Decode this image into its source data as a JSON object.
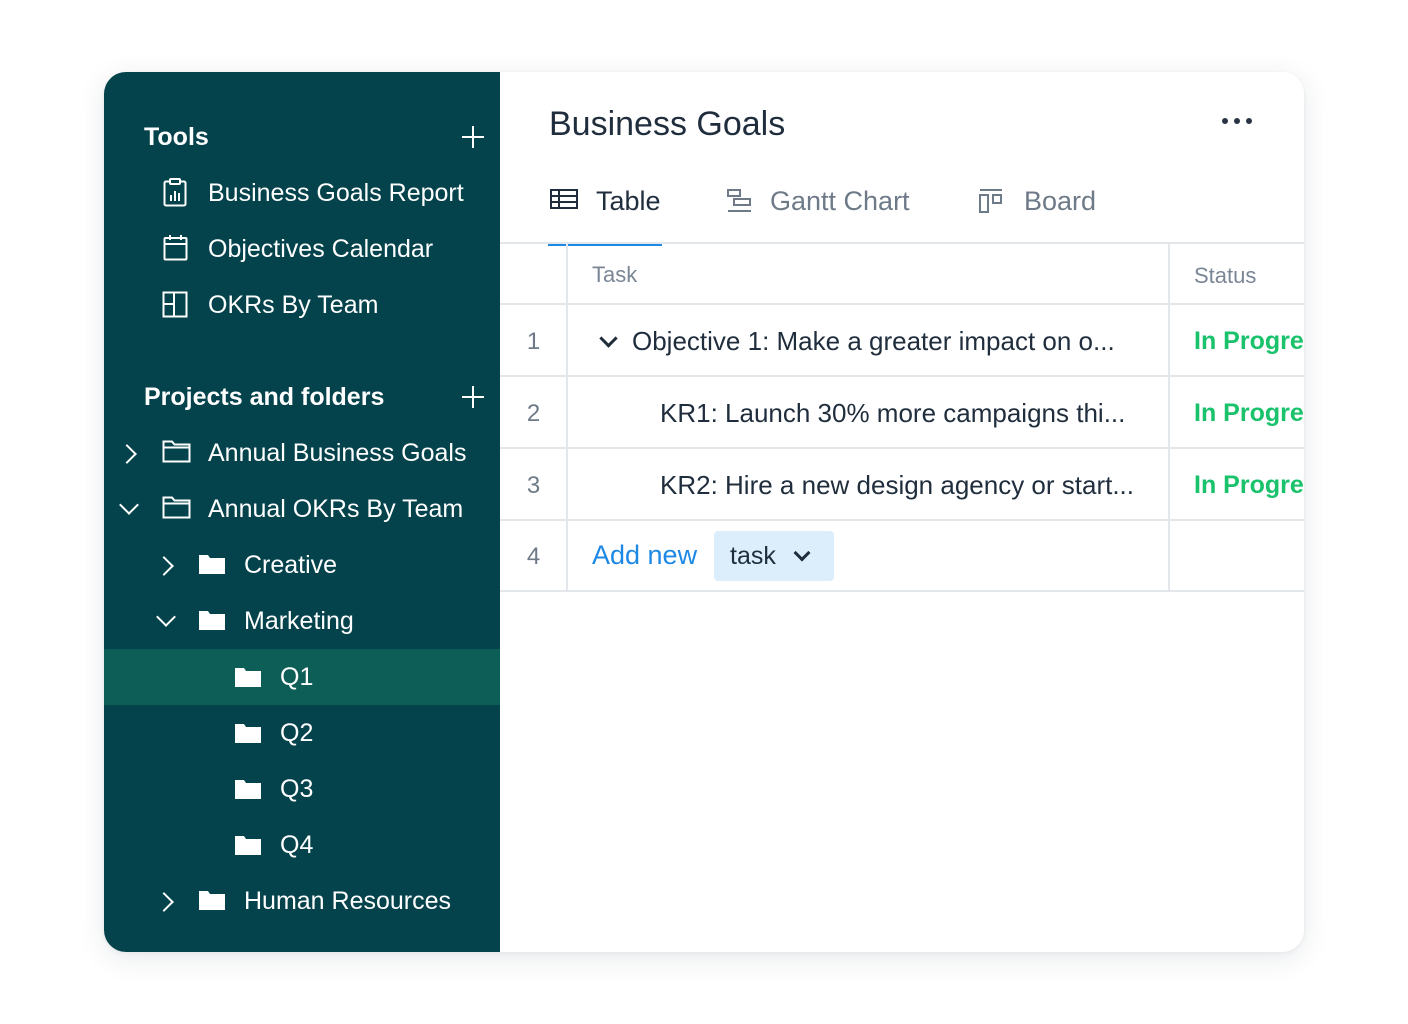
{
  "sidebar": {
    "tools": {
      "title": "Tools",
      "items": [
        {
          "label": "Business Goals Report",
          "icon": "report-icon"
        },
        {
          "label": "Objectives Calendar",
          "icon": "calendar-icon"
        },
        {
          "label": "OKRs By Team",
          "icon": "dashboard-icon"
        }
      ]
    },
    "projects": {
      "title": "Projects and folders",
      "items": [
        {
          "label": "Annual Business Goals",
          "expanded": false
        },
        {
          "label": "Annual OKRs By Team",
          "expanded": true
        },
        {
          "label": "Creative",
          "expanded": false
        },
        {
          "label": "Marketing",
          "expanded": true
        },
        {
          "label": "Q1",
          "selected": true
        },
        {
          "label": "Q2"
        },
        {
          "label": "Q3"
        },
        {
          "label": "Q4"
        },
        {
          "label": "Human Resources",
          "expanded": false
        }
      ]
    }
  },
  "main": {
    "title": "Business Goals",
    "tabs": [
      {
        "label": "Table",
        "active": true
      },
      {
        "label": "Gantt Chart",
        "active": false
      },
      {
        "label": "Board",
        "active": false
      }
    ],
    "table": {
      "columns": [
        "Task",
        "Status"
      ],
      "rows": [
        {
          "num": "1",
          "task": "Objective 1: Make a greater impact on o...",
          "status": "In Progress"
        },
        {
          "num": "2",
          "task": "KR1: Launch 30% more campaigns thi...",
          "status": "In Progress"
        },
        {
          "num": "3",
          "task": "KR2: Hire a new design agency or start...",
          "status": "In Progress"
        },
        {
          "num": "4"
        }
      ],
      "add_new_label": "Add new",
      "add_type": "task"
    }
  },
  "colors": {
    "sidebar_bg": "#05434c",
    "selected_bg": "#0c5e57",
    "accent": "#1e88e5",
    "status_green": "#19c26b"
  }
}
